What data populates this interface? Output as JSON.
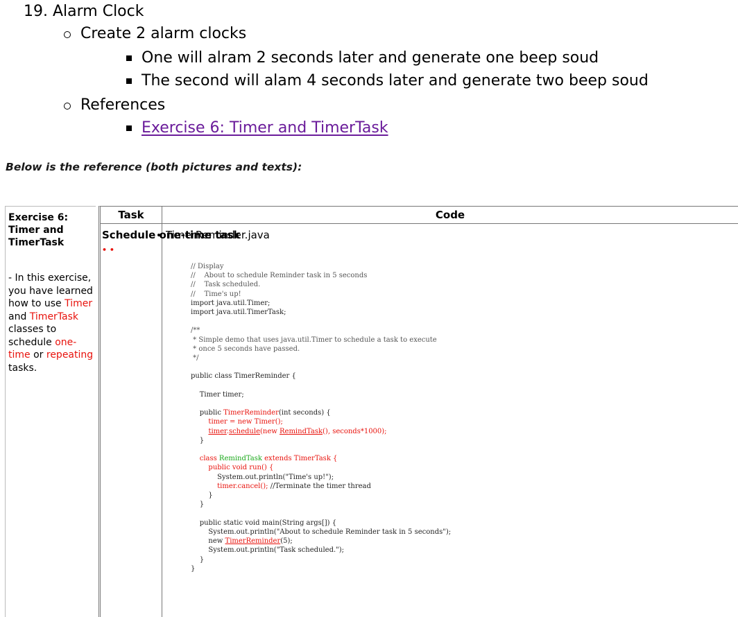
{
  "outline": {
    "title": "19. Alarm Clock",
    "items": [
      {
        "label": "Create 2 alarm clocks",
        "subitems": [
          "One will alram 2 seconds later and generate one beep soud",
          "The second will alam 4 seconds later and generate two beep soud"
        ]
      },
      {
        "label": "References",
        "link": "Exercise 6: Timer and TimerTask"
      }
    ]
  },
  "note": "Below is the reference (both pictures and texts):",
  "reference": {
    "exercise_heading": "Exercise 6: Timer and TimerTask",
    "desc": {
      "p1": "- In this exercise, you have learned how to use ",
      "timer": "Timer",
      "and": " and ",
      "timertask": "TimerTask",
      "p2": " classes to schedule ",
      "onetime": "one-time",
      "or": " or ",
      "repeating": "repeating",
      "tasks": " tasks."
    },
    "table": {
      "col_task": "Task",
      "col_code": "Code",
      "task_name": "Schedule one-time task",
      "task_mark": "• •",
      "file_name": "TimerReminder.java"
    },
    "code": {
      "c1": "// Display",
      "c2": "//    About to schedule Reminder task in 5 seconds",
      "c3": "//    Task scheduled.",
      "c4": "//    Time's up!",
      "i1": "import java.util.Timer;",
      "i2": "import java.util.TimerTask;",
      "d1": "/**",
      "d2": " * Simple demo that uses java.util.Timer to schedule a task to execute",
      "d3": " * once 5 seconds have passed.",
      "d4": " */",
      "k1": "public class TimerReminder {",
      "k2": "    Timer timer;",
      "k3a": "    public ",
      "k3b": "TimerReminder",
      "k3c": "(int seconds) {",
      "k4": "        timer = new Timer();",
      "k5a": "timer",
      "k5b": ".",
      "k5c": "schedule",
      "k5d": "(new ",
      "k5e": "RemindTask",
      "k5f": "(), seconds*1000);",
      "k6": "    }",
      "k7a": "    class ",
      "k7b": "RemindTask",
      "k7c": " extends TimerTask {",
      "k8": "        public void run() {",
      "k9": "            System.out.println(\"Time's up!\");",
      "k10a": "            timer.cancel();",
      "k10b": " //Terminate the timer thread",
      "k11": "        }",
      "k12": "    }",
      "k13": "    public static void main(String args[]) {",
      "k14": "        System.out.println(\"About to schedule Reminder task in 5 seconds\");",
      "k15a": "        new ",
      "k15b": "TimerReminder",
      "k15c": "(5);",
      "k16": "        System.out.println(\"Task scheduled.\");",
      "k17": "    }",
      "k18": "}"
    }
  },
  "colors": {
    "link": "#6a1b9a",
    "highlight_red": "#e8120c",
    "highlight_green": "#1aa81a"
  }
}
